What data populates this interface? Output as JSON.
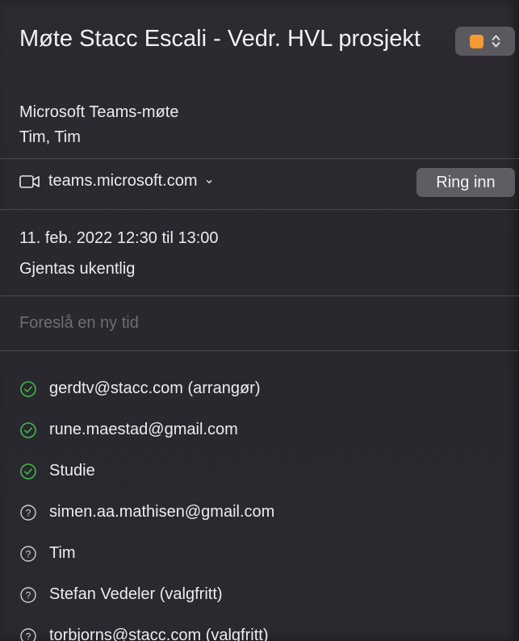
{
  "event": {
    "title": "Møte Stacc Escali - Vedr. HVL prosjekt",
    "color": "#f39a32",
    "location": "Microsoft Teams-møte",
    "organizers": "Tim, Tim"
  },
  "meeting_link": {
    "url_label": "teams.microsoft.com",
    "chevron": "⌄",
    "icon": "video-camera-icon",
    "join_label": "Ring inn"
  },
  "schedule": {
    "date_time": "11. feb. 2022 12:30 til 13:00",
    "recurrence": "Gjentas ukentlig"
  },
  "propose": {
    "label": "Foreslå en ny tid"
  },
  "attendees": [
    {
      "label": "gerdtv@stacc.com (arrangør)",
      "status": "accepted"
    },
    {
      "label": "rune.maestad@gmail.com",
      "status": "accepted"
    },
    {
      "label": "Studie",
      "status": "accepted"
    },
    {
      "label": "simen.aa.mathisen@gmail.com",
      "status": "pending"
    },
    {
      "label": "Tim",
      "status": "pending"
    },
    {
      "label": "Stefan Vedeler (valgfritt)",
      "status": "pending"
    },
    {
      "label": "torbjorns@stacc.com (valgfritt)",
      "status": "pending"
    }
  ],
  "colors": {
    "accepted": "#3dbb48",
    "pending": "#cfcfcf"
  }
}
